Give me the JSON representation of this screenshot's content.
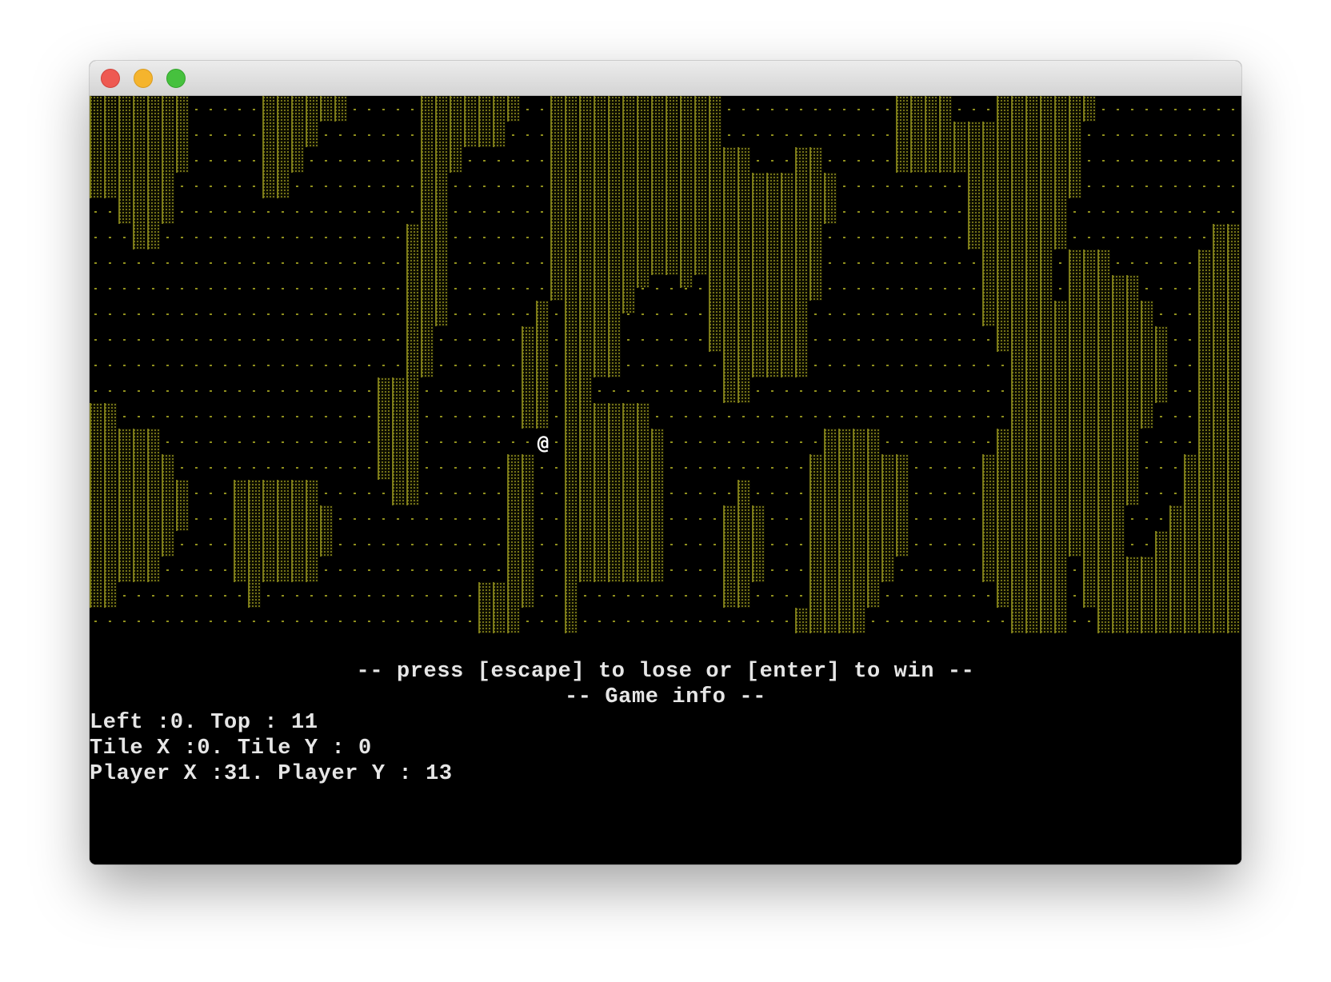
{
  "window": {
    "traffic_lights": [
      "close",
      "minimize",
      "maximize"
    ],
    "colors": {
      "close": "#ee5a52",
      "minimize": "#f5b42d",
      "maximize": "#46c13e"
    }
  },
  "game": {
    "player_glyph": "@",
    "prompt": "-- press [escape] to lose or [enter] to win --",
    "info_title": "-- Game info --",
    "info_lines": [
      "Left :0. Top : 11",
      "Tile X :0. Tile Y : 0",
      "Player X :31. Player Y : 13"
    ],
    "colors": {
      "background": "#000000",
      "wall": "#8d8b1e",
      "floor_dots": "#8f8f1d",
      "text": "#e6e6e6"
    }
  }
}
